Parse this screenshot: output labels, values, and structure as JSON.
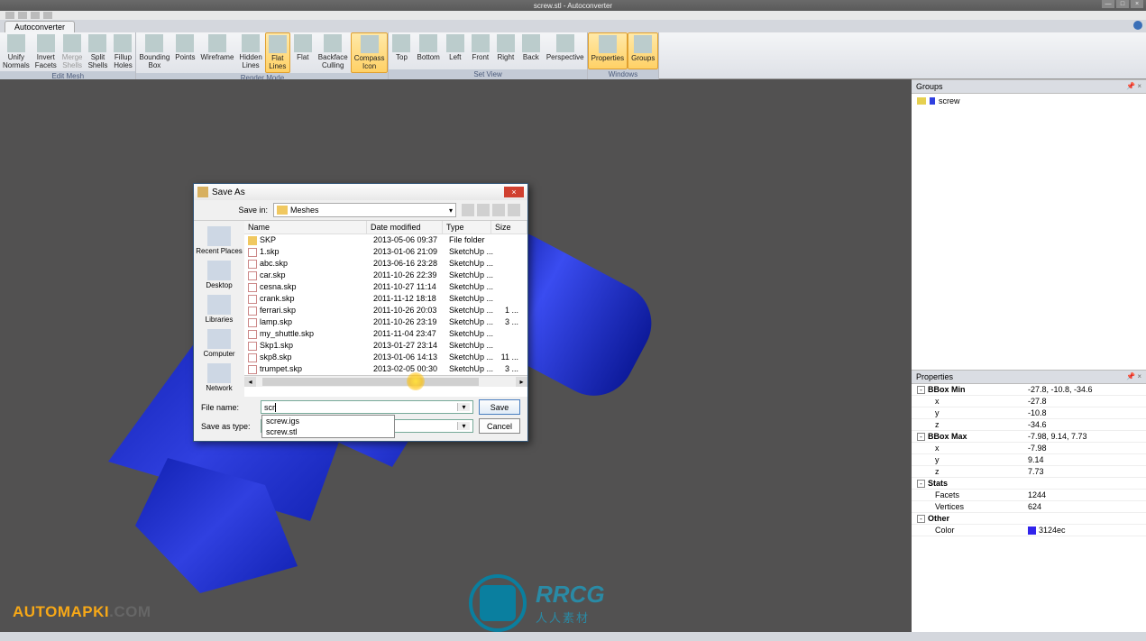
{
  "title": "screw.stl - Autoconverter",
  "tab": "Autoconverter",
  "ribbon": {
    "groups": [
      {
        "title": "Edit Mesh",
        "buttons": [
          {
            "label": "Unify\nNormals",
            "name": "unify-normals-button"
          },
          {
            "label": "Invert\nFacets",
            "name": "invert-facets-button"
          },
          {
            "label": "Merge\nShells",
            "name": "merge-shells-button",
            "disabled": true
          },
          {
            "label": "Split\nShells",
            "name": "split-shells-button"
          },
          {
            "label": "Fillup\nHoles",
            "name": "fillup-holes-button"
          }
        ]
      },
      {
        "title": "Render Mode",
        "buttons": [
          {
            "label": "Bounding\nBox",
            "name": "bounding-box-button"
          },
          {
            "label": "Points",
            "name": "points-button"
          },
          {
            "label": "Wireframe",
            "name": "wireframe-button"
          },
          {
            "label": "Hidden\nLines",
            "name": "hidden-lines-button"
          },
          {
            "label": "Flat\nLines",
            "name": "flat-lines-button",
            "active": true
          },
          {
            "label": "Flat",
            "name": "flat-button"
          },
          {
            "label": "Backface\nCulling",
            "name": "backface-culling-button"
          },
          {
            "label": "Compass\nIcon",
            "name": "compass-icon-button",
            "active": true
          }
        ]
      },
      {
        "title": "Set View",
        "buttons": [
          {
            "label": "Top",
            "name": "top-view-button"
          },
          {
            "label": "Bottom",
            "name": "bottom-view-button"
          },
          {
            "label": "Left",
            "name": "left-view-button"
          },
          {
            "label": "Front",
            "name": "front-view-button"
          },
          {
            "label": "Right",
            "name": "right-view-button"
          },
          {
            "label": "Back",
            "name": "back-view-button"
          },
          {
            "label": "Perspective",
            "name": "perspective-view-button"
          }
        ]
      },
      {
        "title": "Windows",
        "buttons": [
          {
            "label": "Properties",
            "name": "properties-window-button",
            "active": true
          },
          {
            "label": "Groups",
            "name": "groups-window-button",
            "active": true
          }
        ]
      }
    ]
  },
  "groups_panel": {
    "title": "Groups",
    "items": [
      {
        "label": "screw"
      }
    ]
  },
  "properties_panel": {
    "title": "Properties",
    "sections": [
      {
        "key": "BBox Min",
        "val": "-27.8, -10.8, -34.6",
        "children": [
          {
            "key": "x",
            "val": "-27.8"
          },
          {
            "key": "y",
            "val": "-10.8"
          },
          {
            "key": "z",
            "val": "-34.6"
          }
        ]
      },
      {
        "key": "BBox Max",
        "val": "-7.98, 9.14, 7.73",
        "children": [
          {
            "key": "x",
            "val": "-7.98"
          },
          {
            "key": "y",
            "val": "9.14"
          },
          {
            "key": "z",
            "val": "7.73"
          }
        ]
      },
      {
        "key": "Stats",
        "val": "",
        "children": [
          {
            "key": "Facets",
            "val": "1244"
          },
          {
            "key": "Vertices",
            "val": "624"
          }
        ]
      },
      {
        "key": "Other",
        "val": "",
        "children": [
          {
            "key": "Color",
            "val": "3124ec",
            "swatch": "#3124ec"
          }
        ]
      }
    ]
  },
  "dialog": {
    "title": "Save As",
    "save_in_label": "Save in:",
    "save_in_value": "Meshes",
    "places": [
      "Recent Places",
      "Desktop",
      "Libraries",
      "Computer",
      "Network"
    ],
    "columns": [
      "Name",
      "Date modified",
      "Type",
      "Size"
    ],
    "rows": [
      {
        "name": "SKP",
        "date": "2013-05-06 09:37",
        "type": "File folder",
        "size": "",
        "folder": true
      },
      {
        "name": "1.skp",
        "date": "2013-01-06 21:09",
        "type": "SketchUp ...",
        "size": ""
      },
      {
        "name": "abc.skp",
        "date": "2013-06-16 23:28",
        "type": "SketchUp ...",
        "size": ""
      },
      {
        "name": "car.skp",
        "date": "2011-10-26 22:39",
        "type": "SketchUp ...",
        "size": ""
      },
      {
        "name": "cesna.skp",
        "date": "2011-10-27 11:14",
        "type": "SketchUp ...",
        "size": ""
      },
      {
        "name": "crank.skp",
        "date": "2011-11-12 18:18",
        "type": "SketchUp ...",
        "size": ""
      },
      {
        "name": "ferrari.skp",
        "date": "2011-10-26 20:03",
        "type": "SketchUp ...",
        "size": "1 ..."
      },
      {
        "name": "lamp.skp",
        "date": "2011-10-26 23:19",
        "type": "SketchUp ...",
        "size": "3 ..."
      },
      {
        "name": "my_shuttle.skp",
        "date": "2011-11-04 23:47",
        "type": "SketchUp ...",
        "size": ""
      },
      {
        "name": "Skp1.skp",
        "date": "2013-01-27 23:14",
        "type": "SketchUp ...",
        "size": ""
      },
      {
        "name": "skp8.skp",
        "date": "2013-01-06 14:13",
        "type": "SketchUp ...",
        "size": "11 ..."
      },
      {
        "name": "trumpet.skp",
        "date": "2013-02-05 00:30",
        "type": "SketchUp ...",
        "size": "3 ..."
      }
    ],
    "file_name_label": "File name:",
    "file_name_value": "scr",
    "save_as_type_label": "Save as type:",
    "autocomplete": [
      "screw.igs",
      "screw.stl"
    ],
    "save": "Save",
    "cancel": "Cancel"
  },
  "watermark": {
    "left_a": "AUTOMAPKI",
    "left_b": ".COM",
    "center": "RRCG",
    "center_sub": "人人素材"
  }
}
